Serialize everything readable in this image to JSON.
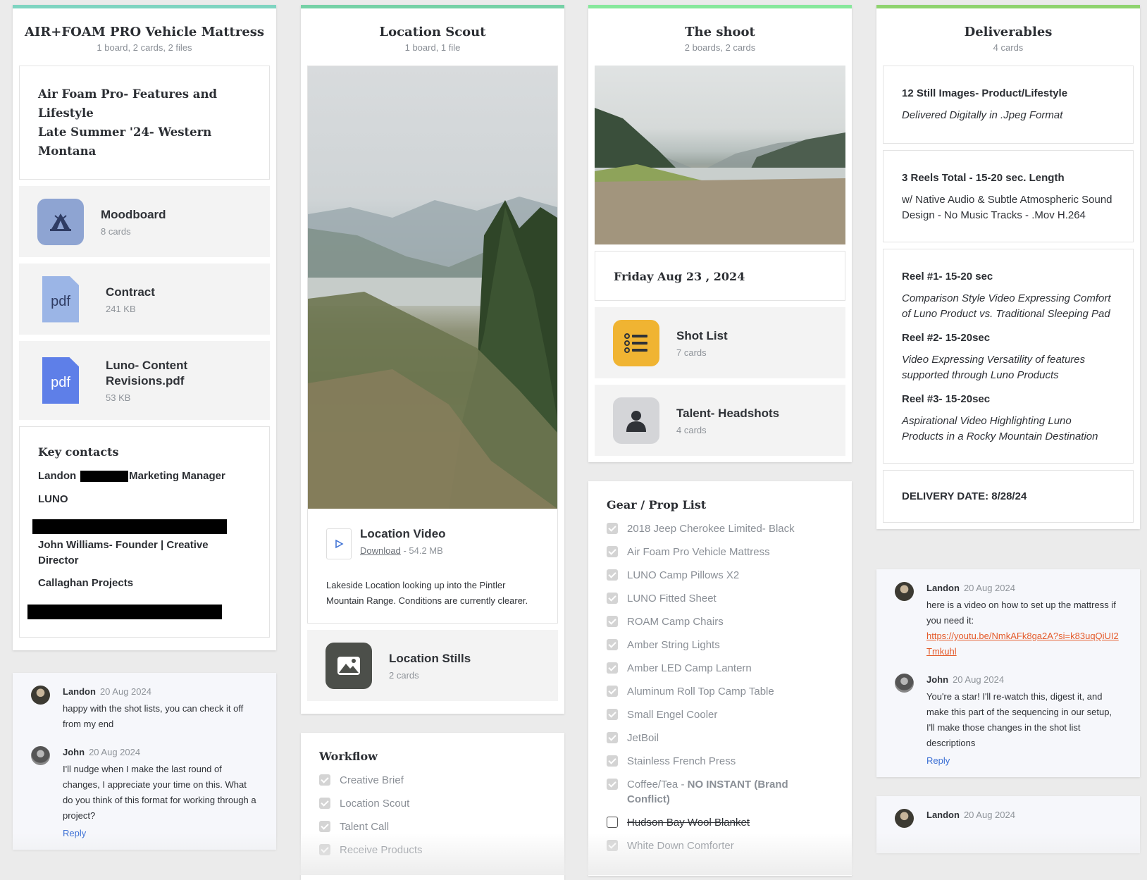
{
  "colors": {
    "col1_accent": "#7fd4c1",
    "col2_accent": "#75d1a6",
    "col3_accent": "#87e89c",
    "col4_accent": "#8fd36f",
    "moodboard_thumb": "#8ea4d2",
    "pdf_light": "#9bb5e6",
    "pdf_dark": "#5e7fe8",
    "shotlist_thumb": "#f0b432",
    "headshots_thumb": "#d4d5d8",
    "stills_thumb": "#4c4f4a",
    "link": "#e45a2a",
    "reply": "#3b6fd4"
  },
  "col1": {
    "title": "AIR+FOAM PRO Vehicle Mattress",
    "subtitle": "1 board, 2 cards, 2 files",
    "intro_line1": "Air Foam Pro- Features and Lifestyle",
    "intro_line2": "Late Summer '24- Western Montana",
    "moodboard": {
      "title": "Moodboard",
      "sub": "8 cards",
      "icon": "tent-icon"
    },
    "contract": {
      "title": "Contract",
      "sub": "241 KB",
      "icon_label": "pdf"
    },
    "revisions": {
      "title": "Luno- Content Revisions.pdf",
      "sub": "53 KB",
      "icon_label": "pdf"
    },
    "contacts": {
      "heading": "Key contacts",
      "c1_first": "Landon",
      "c1_role": "Marketing Manager",
      "c1_company": "LUNO",
      "c2_name": "John Williams- Founder | Creative Director",
      "c2_company": "Callaghan Projects"
    },
    "comments": [
      {
        "name": "Landon",
        "date": "20 Aug 2024",
        "text": "happy with the shot lists, you can check it off from my end"
      },
      {
        "name": "John",
        "date": "20 Aug 2024",
        "text": "I'll nudge when I make the last round of changes, I appreciate your time on this. What do you think of this format for working through a project?"
      }
    ],
    "reply": "Reply"
  },
  "col2": {
    "title": "Location Scout",
    "subtitle": "1 board, 1 file",
    "video": {
      "title": "Location Video",
      "download": "Download",
      "size": "- 54.2 MB",
      "desc": "Lakeside Location looking up into the Pintler Mountain Range. Conditions are currently clearer."
    },
    "stills": {
      "title": "Location Stills",
      "sub": "2 cards"
    },
    "workflow": {
      "heading": "Workflow",
      "items": [
        "Creative Brief",
        "Location Scout",
        "Talent Call",
        "Receive Products"
      ]
    }
  },
  "col3": {
    "title": "The shoot",
    "subtitle": "2 boards, 2 cards",
    "date": "Friday Aug 23 , 2024",
    "shotlist": {
      "title": "Shot List",
      "sub": "7 cards"
    },
    "headshots": {
      "title": "Talent- Headshots",
      "sub": "4 cards"
    },
    "gear": {
      "heading": "Gear / Prop List",
      "items": [
        "2018 Jeep Cherokee Limited- Black",
        "Air Foam Pro Vehicle Mattress",
        "LUNO Camp Pillows X2",
        "LUNO Fitted Sheet",
        "ROAM Camp Chairs",
        "Amber String Lights",
        "Amber LED Camp Lantern",
        "Aluminum Roll Top Camp Table",
        "Small Engel Cooler",
        "JetBoil",
        "Stainless French Press"
      ],
      "coffee_prefix": "Coffee/Tea - ",
      "coffee_bold": "NO INSTANT (Brand Conflict)",
      "unchecked_item": "Hudson Bay Wool Blanket",
      "last_item": "White Down Comforter"
    }
  },
  "col4": {
    "title": "Deliverables",
    "subtitle": "4 cards",
    "d1_title": "12 Still Images- Product/Lifestyle",
    "d1_text": "Delivered Digitally in .Jpeg Format",
    "d2_title": "3 Reels Total - 15-20 sec. Length",
    "d2_text": "w/ Native Audio & Subtle Atmospheric Sound Design - No Music Tracks - .Mov H.264",
    "r1_title": "Reel #1- 15-20 sec",
    "r1_text": "Comparison Style Video Expressing Comfort of Luno Product vs. Traditional Sleeping Pad",
    "r2_title": "Reel #2- 15-20sec",
    "r2_text": "Video Expressing Versatility of features supported through Luno Products",
    "r3_title": "Reel #3- 15-20sec",
    "r3_text": "Aspirational Video Highlighting Luno Products in a Rocky Mountain Destination",
    "delivery": "DELIVERY DATE: 8/28/24",
    "comments": [
      {
        "name": "Landon",
        "date": "20 Aug 2024",
        "text": "here is a video on how to set up the mattress if you need it:",
        "link": "https://youtu.be/NmkAFk8ga2A?si=k83uqQiUI2Tmkuhl"
      },
      {
        "name": "John",
        "date": "20 Aug 2024",
        "text": "You're a star! I'll re-watch this, digest it, and make this part of the sequencing in our setup, I'll make those changes in the shot list descriptions"
      }
    ],
    "reply": "Reply",
    "next_comment": {
      "name": "Landon",
      "date": "20 Aug 2024"
    }
  }
}
